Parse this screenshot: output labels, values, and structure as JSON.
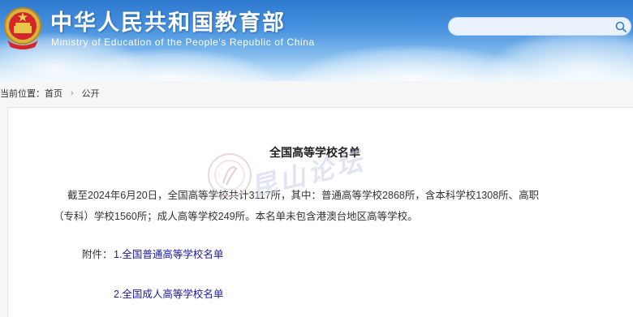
{
  "header": {
    "title_cn": "中华人民共和国教育部",
    "title_en": "Ministry of Education of the People's Republic of China",
    "emblem_icon": "national-emblem-icon",
    "search": {
      "placeholder": "",
      "icon": "search-icon"
    },
    "colors": {
      "sky_top": "#2f79cf",
      "sky_bottom": "#dff0fb"
    }
  },
  "breadcrumb": {
    "prefix": "当前位置：",
    "items": [
      "首页",
      "公开"
    ],
    "separator": "›"
  },
  "article": {
    "title": "全国高等学校名单",
    "paragraph_line1": "截至2024年6月20日，全国高等学校共计3117所，其中：普通高等学校2868所，含本科学校1308所、高职",
    "paragraph_line2": "（专科）学校1560所；成人高等学校249所。本名单未包含港澳台地区高等学校。",
    "attachments_label": "附件：",
    "attachments": [
      "1.全国普通高等学校名单",
      "2.全国成人高等学校名单"
    ],
    "link_color": "#1a1aa6"
  },
  "watermark": {
    "text": "昆山论坛"
  }
}
